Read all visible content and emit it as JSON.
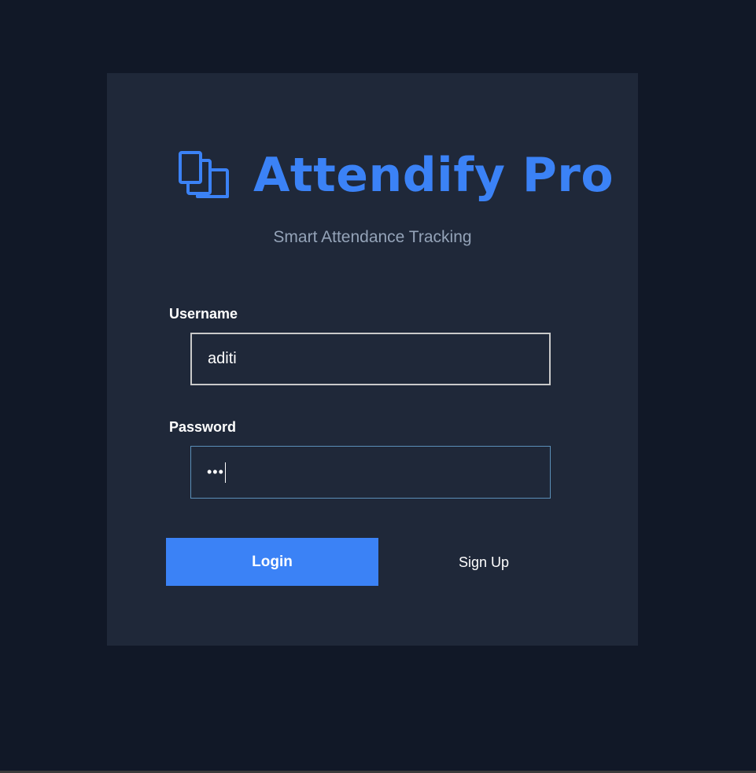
{
  "brand": {
    "icon": "books-icon",
    "title": "Attendify Pro",
    "subtitle": "Smart Attendance Tracking",
    "accent_color": "#3b82f6"
  },
  "form": {
    "username_label": "Username",
    "username_value": "aditi",
    "password_label": "Password",
    "password_masked": "•••"
  },
  "actions": {
    "login_label": "Login",
    "signup_label": "Sign Up"
  }
}
